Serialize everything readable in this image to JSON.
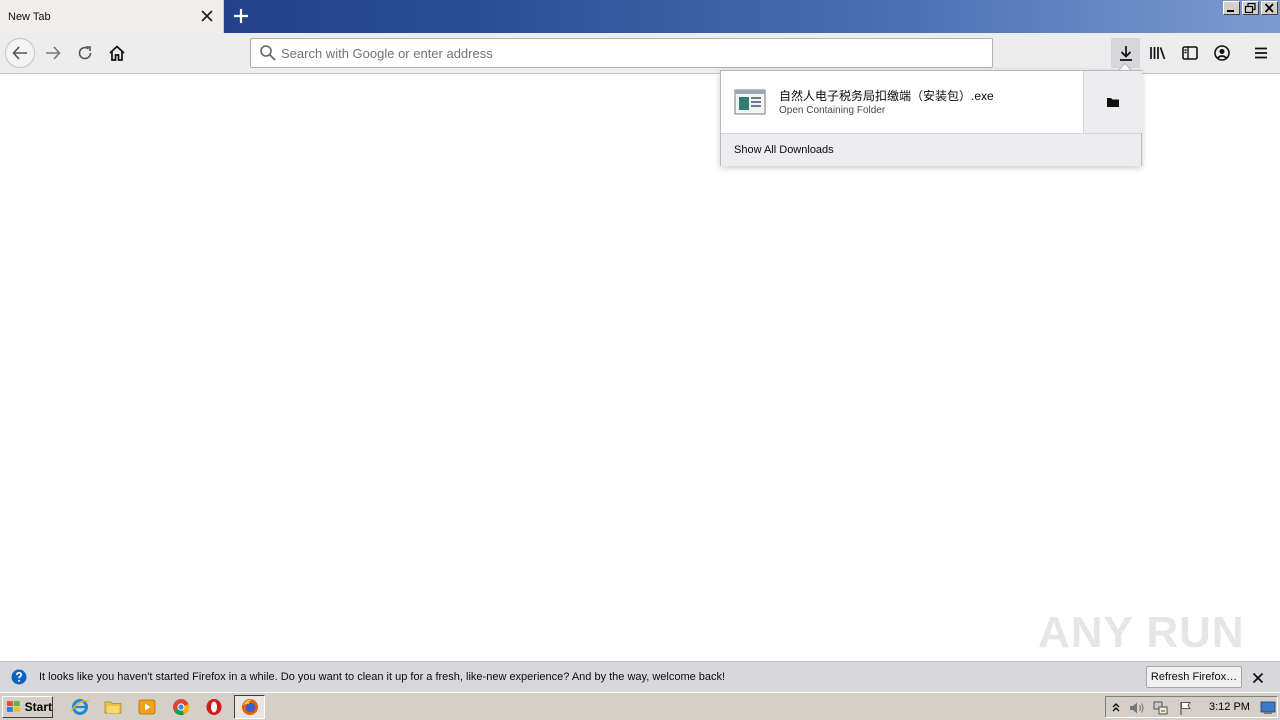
{
  "browser": {
    "tab_title": "New Tab",
    "url_placeholder": "Search with Google or enter address"
  },
  "downloads_panel": {
    "items": [
      {
        "filename": "自然人电子税务局扣缴端（安装包）.exe",
        "status": "Open Containing Folder"
      }
    ],
    "show_all_label": "Show All Downloads"
  },
  "notification": {
    "message": "It looks like you haven't started Firefox in a while. Do you want to clean it up for a fresh, like-new experience? And by the way, welcome back!",
    "button_label": "Refresh Firefox…"
  },
  "taskbar": {
    "start_label": "Start",
    "clock": "3:12 PM"
  },
  "watermark": "ANY RUN",
  "icons": {
    "back": "back-arrow-icon",
    "forward": "forward-arrow-icon",
    "reload": "reload-icon",
    "home": "home-icon",
    "download": "download-icon",
    "library": "library-icon",
    "sidebar": "sidebar-icon",
    "account": "account-icon",
    "menu": "hamburger-menu-icon"
  },
  "colors": {
    "titlebar_start": "#1f3a82",
    "titlebar_end": "#7d9bd0",
    "toolbar": "#ededed",
    "notification_bar": "#d8d8dc",
    "taskbar": "#d4d0c8"
  }
}
